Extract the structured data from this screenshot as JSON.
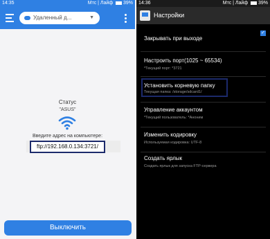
{
  "left": {
    "statusbar": {
      "time": "14:35",
      "carriers": "Мтс | Лайф",
      "battery": "39%"
    },
    "server_chip": {
      "label": "Удаленный д...",
      "caret": "▼"
    },
    "status_title": "Статус",
    "device_name": "\"ASUS\"",
    "enter_label": "Введите адрес на компьютере:",
    "ftp_address": "ftp://192.168.0.134:3721/",
    "off_button": "Выключить"
  },
  "right": {
    "statusbar": {
      "time": "14:36",
      "carriers": "Мтс | Лайф",
      "battery": "39%"
    },
    "title": "Настройки",
    "prefs": [
      {
        "title": "Закрывать при выходе",
        "subtitle": "",
        "checked": true
      },
      {
        "title": "Настроить порт(1025 ~ 65534)",
        "subtitle": "*Текущий порт: *3721"
      },
      {
        "title": "Установить корневую папку",
        "subtitle": "Текущая папка: /storage/sdcard1/"
      },
      {
        "title": "Управление аккаунтом",
        "subtitle": "*Текущий пользователь: *Аноним"
      },
      {
        "title": "Изменить кодировку",
        "subtitle": "Используемая кодировка: UTF-8"
      },
      {
        "title": "Создать ярлык",
        "subtitle": "Создать ярлык для запуска FTP-сервера"
      }
    ]
  },
  "colors": {
    "accent": "#2f80e3",
    "highlight_border": "#1c2a6b",
    "dark_bg": "#000000"
  }
}
